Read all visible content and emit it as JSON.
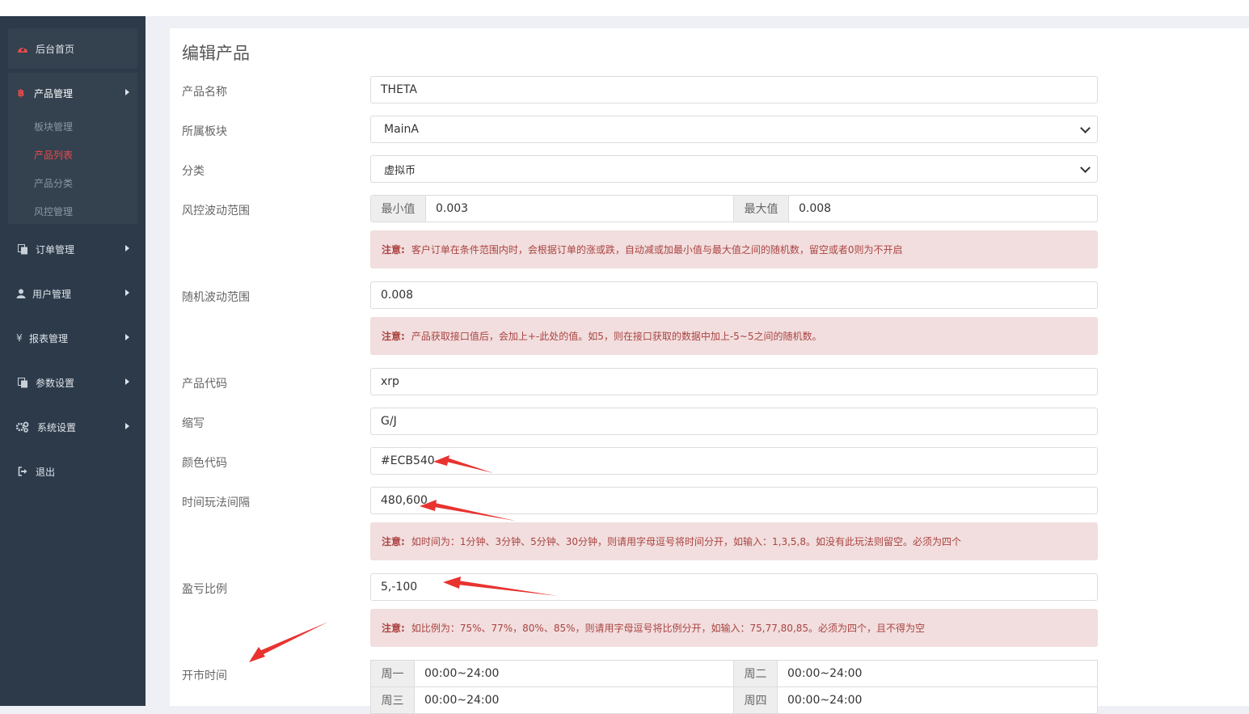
{
  "sidebar": {
    "home": {
      "label": "后台首页",
      "icon": "dashboard-icon"
    },
    "product": {
      "label": "产品管理",
      "icon": "bitcoin-icon"
    },
    "product_sub": [
      {
        "label": "板块管理"
      },
      {
        "label": "产品列表"
      },
      {
        "label": "产品分类"
      },
      {
        "label": "风控管理"
      }
    ],
    "items": [
      {
        "label": "订单管理",
        "icon": "copy-icon"
      },
      {
        "label": "用户管理",
        "icon": "user-icon"
      },
      {
        "label": "报表管理",
        "icon": "yen-icon"
      },
      {
        "label": "参数设置",
        "icon": "copy-icon"
      },
      {
        "label": "系统设置",
        "icon": "gears-icon"
      },
      {
        "label": "退出",
        "icon": "sign-out-icon"
      }
    ]
  },
  "form": {
    "title": "编辑产品",
    "name": {
      "label": "产品名称",
      "value": "THETA"
    },
    "board": {
      "label": "所属板块",
      "value": "MainA"
    },
    "category": {
      "label": "分类",
      "value": "虚拟币"
    },
    "risk": {
      "label": "风控波动范围",
      "min_label": "最小值",
      "min_value": "0.003",
      "max_label": "最大值",
      "max_value": "0.008"
    },
    "risk_note": {
      "prefix": "注意:",
      "text": "客户订单在条件范围内时，会根据订单的涨或跌，自动减或加最小值与最大值之间的随机数，留空或者0则为不开启"
    },
    "random": {
      "label": "随机波动范围",
      "value": "0.008"
    },
    "random_note": {
      "prefix": "注意:",
      "text": "产品获取接口值后，会加上+-此处的值。如5，则在接口获取的数据中加上-5~5之间的随机数。"
    },
    "code": {
      "label": "产品代码",
      "value": "xrp"
    },
    "abbr": {
      "label": "缩写",
      "value": "G/J"
    },
    "color": {
      "label": "颜色代码",
      "value": "#ECB540"
    },
    "interval": {
      "label": "时间玩法间隔",
      "value": "480,600"
    },
    "interval_note": {
      "prefix": "注意:",
      "text": "如时间为：1分钟、3分钟、5分钟、30分钟，则请用字母逗号将时间分开，如输入：1,3,5,8。如没有此玩法则留空。必须为四个"
    },
    "ratio": {
      "label": "盈亏比例",
      "value": "5,-100"
    },
    "ratio_note": {
      "prefix": "注意:",
      "text": "如比例为：75%、77%，80%、85%，则请用字母逗号将比例分开，如输入：75,77,80,85。必须为四个，且不得为空"
    },
    "open": {
      "label": "开市时间",
      "days": [
        {
          "day": "周一",
          "time": "00:00~24:00"
        },
        {
          "day": "周二",
          "time": "00:00~24:00"
        },
        {
          "day": "周三",
          "time": "00:00~24:00"
        },
        {
          "day": "周四",
          "time": "00:00~24:00"
        }
      ]
    }
  },
  "colors": {
    "sidebar": "#2c3a4a",
    "accent": "#e84b4b",
    "alert_bg": "#f2dede",
    "alert_text": "#a94442",
    "arrow": "#e8332f"
  }
}
